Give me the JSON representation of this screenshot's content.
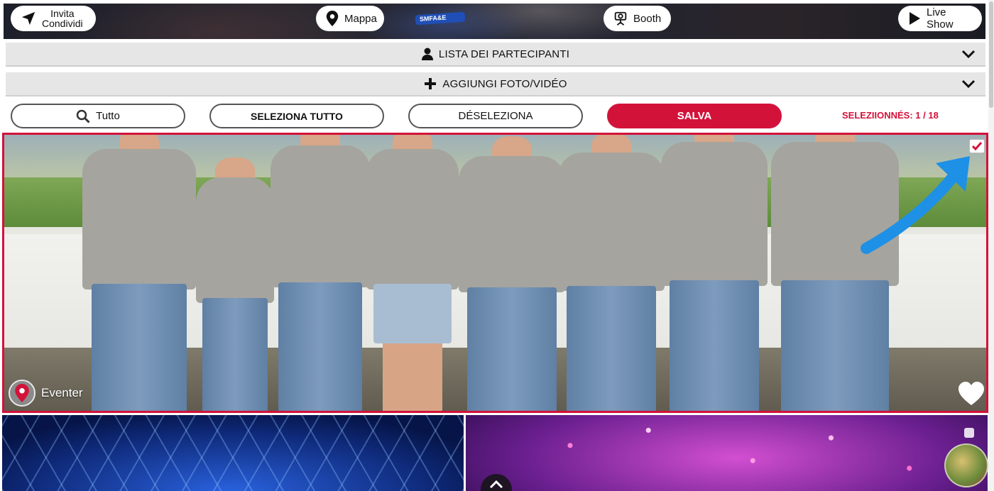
{
  "header": {
    "invite_line1": "Invita",
    "invite_line2": "Condividi",
    "map_label": "Mappa",
    "booth_label": "Booth",
    "live_label": "Live Show",
    "wristband_text": "SMFA&E"
  },
  "accordions": {
    "participants_label": "LISTA DEI PARTECIPANTI",
    "add_media_label": "AGGIUNGI FOTO/VIDÉO"
  },
  "toolbar": {
    "search_label": "Tutto",
    "select_all_label": "SELEZIONA TUTTO",
    "deselect_label": "DÉSELEZIONA",
    "save_label": "SALVA",
    "selection_count": "SELEZIIONNÉS: 1 / 18"
  },
  "photo": {
    "source_label": "Eventer",
    "selected": true
  },
  "colors": {
    "accent": "#d3123a",
    "arrow": "#1e90e6",
    "accordion_bg": "#e6e6e6"
  },
  "icons": {
    "invite": "send-icon",
    "map": "map-pin-icon",
    "booth": "camera-icon",
    "live": "play-icon",
    "participants": "user-icon",
    "add_media": "plus-icon",
    "search": "search-icon",
    "favorite": "heart-icon",
    "scroll_top": "chevron-up-icon"
  }
}
